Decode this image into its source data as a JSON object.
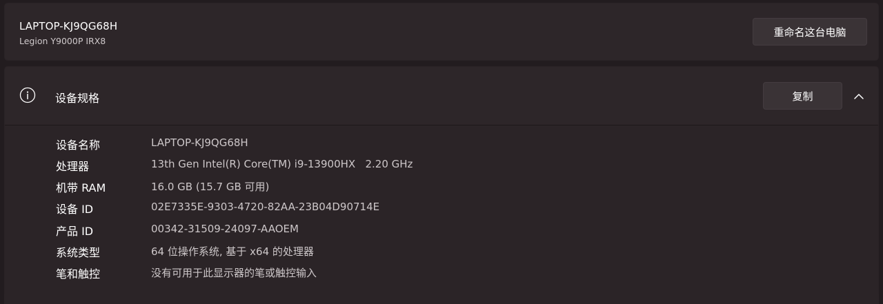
{
  "device": {
    "name": "LAPTOP-KJ9QG68H",
    "model": "Legion Y9000P IRX8",
    "rename_label": "重命名这台电脑"
  },
  "specs": {
    "title": "设备规格",
    "copy_label": "复制",
    "icons": {
      "section": "info-icon",
      "toggle": "chevron-up-icon"
    },
    "rows": [
      {
        "label": "设备名称",
        "value": "LAPTOP-KJ9QG68H"
      },
      {
        "label": "处理器",
        "value": "13th Gen Intel(R) Core(TM) i9-13900HX   2.20 GHz"
      },
      {
        "label": "机带 RAM",
        "value": "16.0 GB (15.7 GB 可用)"
      },
      {
        "label": "设备 ID",
        "value": "02E7335E-9303-4720-82AA-23B04D90714E"
      },
      {
        "label": "产品 ID",
        "value": "00342-31509-24097-AAOEM"
      },
      {
        "label": "系统类型",
        "value": "64 位操作系统, 基于 x64 的处理器"
      },
      {
        "label": "笔和触控",
        "value": "没有可用于此显示器的笔或触控输入"
      }
    ]
  },
  "colors": {
    "background": "#221c1f",
    "card": "#2d2629",
    "button": "#3a3336",
    "text_primary": "#ffffff",
    "text_secondary": "#cdc7c9"
  }
}
